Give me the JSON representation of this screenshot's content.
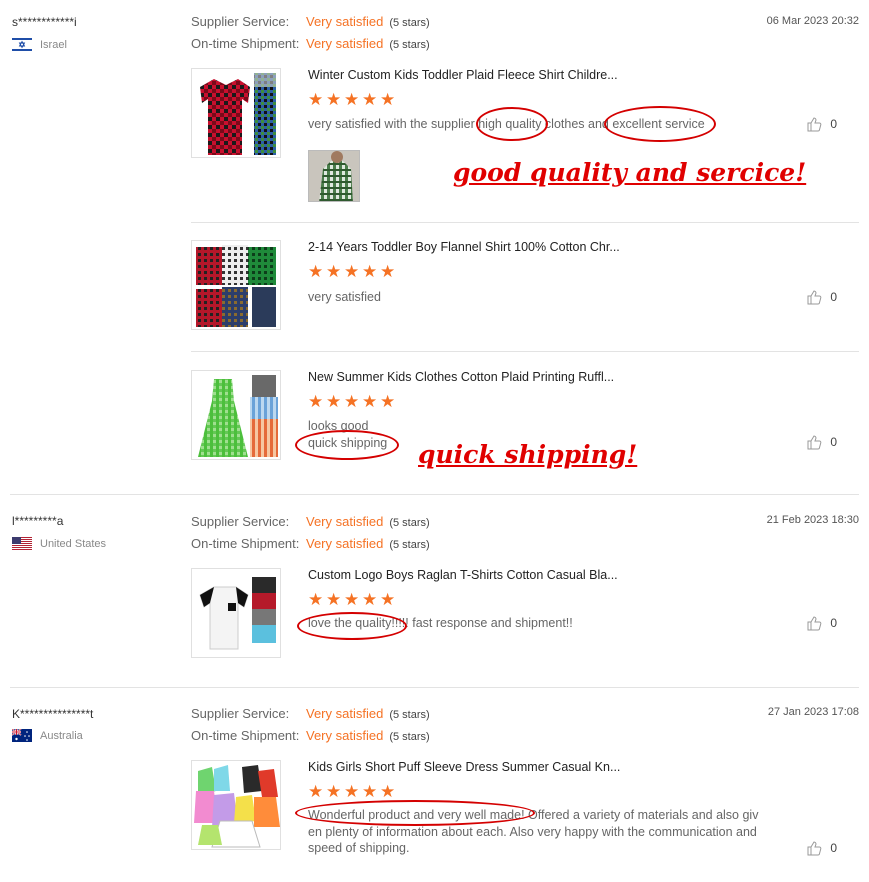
{
  "labels": {
    "supplier_service": "Supplier Service:",
    "ontime_shipment": "On-time Shipment:",
    "very_satisfied": "Very satisfied",
    "five_stars": "(5 stars)"
  },
  "colors": {
    "accent": "#f57224",
    "annotation": "#e00000"
  },
  "reviews": [
    {
      "user": "s************i",
      "country": "Israel",
      "flag_icon": "israel-flag-icon",
      "date": "06 Mar 2023 20:32",
      "items": [
        {
          "title": "Winter Custom Kids Toddler Plaid Fleece Shirt Childre...",
          "rating": 5,
          "comment": "very satisfied with the supplier high quality clothes and excellent service",
          "likes": "0",
          "has_photo": true
        },
        {
          "title": "2-14 Years Toddler Boy Flannel Shirt 100% Cotton Chr...",
          "rating": 5,
          "comment": "very satisfied",
          "likes": "0"
        },
        {
          "title": "New Summer Kids Clothes Cotton Plaid Printing Ruffl...",
          "rating": 5,
          "comment_line1": "looks good",
          "comment_line2": "quick shipping",
          "likes": "0"
        }
      ]
    },
    {
      "user": "l*********a",
      "country": "United States",
      "flag_icon": "us-flag-icon",
      "date": "21 Feb 2023 18:30",
      "items": [
        {
          "title": "Custom Logo Boys Raglan T-Shirts Cotton Casual Bla...",
          "rating": 5,
          "comment": "love the quality!!!!! fast response and shipment!!",
          "likes": "0"
        }
      ]
    },
    {
      "user": "K***************t",
      "country": "Australia",
      "flag_icon": "australia-flag-icon",
      "date": "27 Jan 2023 17:08",
      "items": [
        {
          "title": "Kids Girls Short Puff Sleeve Dress Summer Casual Kn...",
          "rating": 5,
          "comment_line1": "Wonderful product and very well made! Offered a variety of materials and also giv",
          "comment_line2": "en plenty of information about each. Also very happy with the communication and",
          "comment_line3": "speed of shipping.",
          "likes": "0"
        }
      ]
    }
  ],
  "annotations": {
    "note1": "good quality and sercice!",
    "note2": "quick shipping!"
  }
}
